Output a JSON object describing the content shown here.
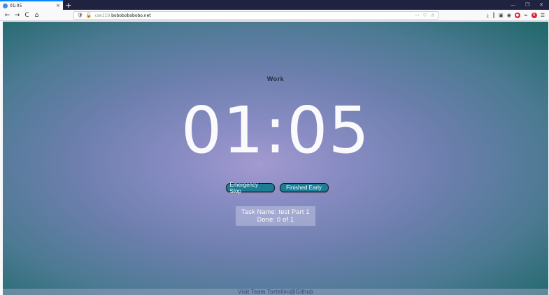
{
  "browser": {
    "tab_title": "01:05",
    "tab_close": "×",
    "new_tab": "+",
    "window_controls": [
      "—",
      "❐",
      "✕"
    ],
    "nav": {
      "back": "←",
      "forward": "→",
      "reload": "C",
      "home": "⌂"
    },
    "url_scheme": "cse110.",
    "url_host": "bobobobobobo.net",
    "url_actions": [
      "···",
      "♡",
      "☆"
    ],
    "toolbar_icons": [
      "download-icon",
      "library-icon",
      "sidebar-icon",
      "account-icon",
      "addon-icon",
      "pocket-icon",
      "notification-icon",
      "menu-icon"
    ],
    "badge": "8"
  },
  "app": {
    "mode_label": "Work",
    "timer_display": "01:05",
    "buttons": {
      "emergency_stop": "Emergency Stop",
      "finished_early": "Finished Early"
    },
    "task": {
      "name_line": "Task Name: test Part 1",
      "done_line": "Done: 0 of 1"
    },
    "footer_link": "Visit Team Tortellini@Github"
  },
  "colors": {
    "accent_button": "#1b7e94",
    "background_center": "#a29ad0",
    "background_edge": "#1f6769",
    "timer_text": "#fafafc"
  }
}
